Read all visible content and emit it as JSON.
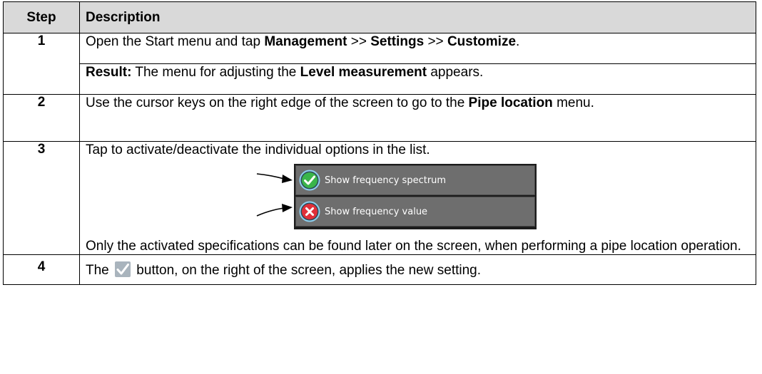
{
  "header": {
    "step": "Step",
    "description": "Description"
  },
  "steps": [
    {
      "number": "1",
      "parts": [
        "Open the Start menu and tap ",
        "Management",
        " >> ",
        "Settings",
        " >> ",
        "Customize",
        "."
      ],
      "result_label": "Result:",
      "result_parts": [
        " The menu for adjusting the ",
        "Level measurement",
        " appears."
      ]
    },
    {
      "number": "2",
      "parts": [
        "Use the cursor keys on the right edge of the screen to go to the ",
        "Pipe location",
        " menu."
      ]
    },
    {
      "number": "3",
      "text": "Tap to activate/deactivate the individual options in the list.",
      "options": [
        {
          "label": "Show frequency spectrum",
          "state": "activated",
          "icon": "green-check-icon"
        },
        {
          "label": "Show frequency value",
          "state": "deactivated",
          "icon": "red-x-icon"
        }
      ],
      "note": "Only the activated specifications can be found later on the screen, when performing a pipe location operation."
    },
    {
      "number": "4",
      "parts": [
        "The ",
        " button, on the right of the screen, applies the new setting."
      ],
      "icon": "checkmark-button-icon"
    }
  ],
  "colors": {
    "header_bg": "#d9d9d9",
    "ui_bg": "#6e6e6e",
    "check_green": "#3ab54a",
    "x_red": "#e0303a",
    "icon_ring": "#8fd0f0"
  }
}
